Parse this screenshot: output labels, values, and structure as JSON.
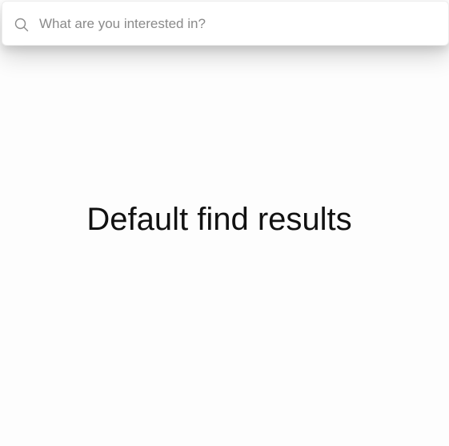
{
  "search": {
    "placeholder": "What are you interested in?",
    "value": "",
    "icon": "search-icon"
  },
  "main": {
    "heading": "Default find results"
  },
  "colors": {
    "page_background": "#fdfdfd",
    "search_background": "#ffffff",
    "placeholder_text": "#8a8a8a",
    "heading_text": "#111111"
  }
}
